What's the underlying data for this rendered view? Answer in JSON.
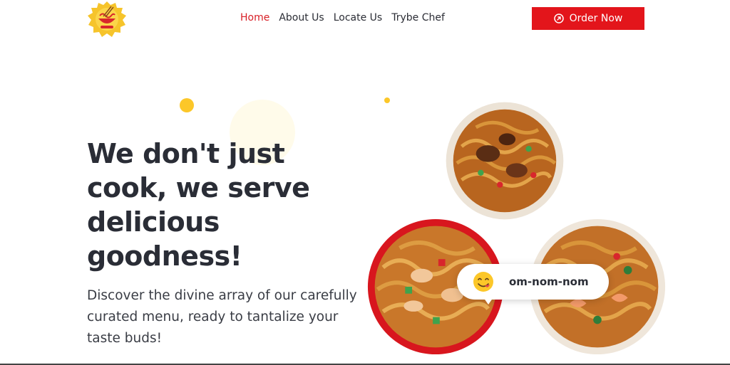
{
  "brand": {
    "logo_icon": "noodle-bowl-logo-icon",
    "accent": "#e3151b",
    "yellow": "#fcc729"
  },
  "nav": {
    "items": [
      {
        "label": "Home",
        "active": true
      },
      {
        "label": "About Us",
        "active": false
      },
      {
        "label": "Locate Us",
        "active": false
      },
      {
        "label": "Trybe Chef",
        "active": false
      }
    ]
  },
  "cta": {
    "label": "Order Now",
    "icon": "arrow-up-right-circle-icon"
  },
  "hero": {
    "headline": "We don't just cook, we serve delicious goodness!",
    "subtext": "Discover the divine array of our carefully curated menu, ready to tantalize your taste buds!"
  },
  "bubble": {
    "emoji": "yum-face-emoji",
    "text": "om-nom-nom"
  }
}
